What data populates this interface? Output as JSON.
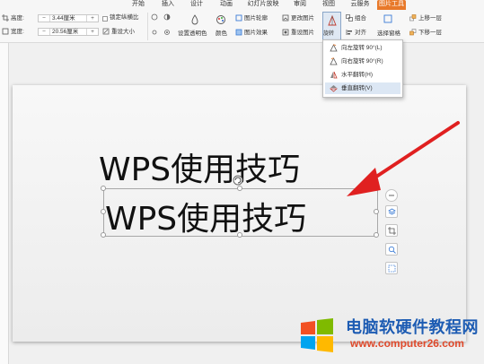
{
  "tabs": [
    "开始",
    "插入",
    "设计",
    "动画",
    "幻灯片放映",
    "审阅",
    "视图",
    "云服务",
    "图片工具"
  ],
  "active_tab": "图片工具",
  "ribbon": {
    "height_label": "高度:",
    "height_value": "3.44厘米",
    "width_label": "宽度:",
    "width_value": "20.56厘米",
    "minus": "−",
    "plus": "+",
    "lock_ratio": "锁定纵横比",
    "reset_size": "重设大小",
    "set_transparent": "设置透明色",
    "color": "颜色",
    "picture_outline": "图片轮廓",
    "picture_effect": "图片效果",
    "change_picture": "更改图片",
    "reset_picture": "重设图片",
    "rotate": "旋转",
    "group": "组合",
    "align": "对齐",
    "selection_pane": "选择窗格",
    "bring_forward": "上移一层",
    "send_backward": "下移一层"
  },
  "rotate_menu": [
    {
      "label": "向左旋转 90°(L)",
      "icon": "rotate-left-icon"
    },
    {
      "label": "向右旋转 90°(R)",
      "icon": "rotate-right-icon"
    },
    {
      "label": "水平翻转(H)",
      "icon": "flip-horizontal-icon"
    },
    {
      "label": "垂直翻转(V)",
      "icon": "flip-vertical-icon"
    }
  ],
  "slide": {
    "line1": "WPS使用技巧",
    "line2": "WPS使用技巧"
  },
  "watermark": {
    "title": "电脑软硬件教程网",
    "url": "www.computer26.com"
  },
  "colors": {
    "accent": "#e8792a",
    "arrow": "#e02020",
    "menu_hover": "#dce7f4"
  }
}
